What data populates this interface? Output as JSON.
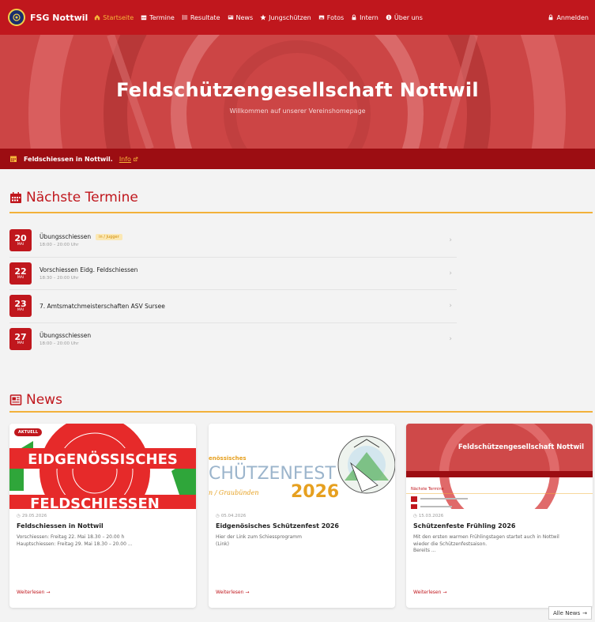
{
  "nav": {
    "brand": "FSG Nottwil",
    "items": [
      {
        "label": "Startseite",
        "icon": "home-icon",
        "active": true
      },
      {
        "label": "Termine",
        "icon": "calendar-icon"
      },
      {
        "label": "Resultate",
        "icon": "list-icon"
      },
      {
        "label": "News",
        "icon": "newspaper-icon"
      },
      {
        "label": "Jungschützen",
        "icon": "star-icon"
      },
      {
        "label": "Fotos",
        "icon": "images-icon"
      },
      {
        "label": "Intern",
        "icon": "lock-icon"
      },
      {
        "label": "Über uns",
        "icon": "info-icon"
      }
    ],
    "login": "Anmelden"
  },
  "hero": {
    "title": "Feldschützengesellschaft Nottwil",
    "subtitle": "Willkommen auf unserer Vereinshomepage"
  },
  "announcement": {
    "text": "Feldschiessen in Nottwil.",
    "link": "Info"
  },
  "events_section": {
    "title": "Nächste Termine",
    "events": [
      {
        "day": "20",
        "month": "MAI",
        "title": "Übungsschiessen",
        "tag": "in / Jugger",
        "time": "18:00 – 20:00 Uhr"
      },
      {
        "day": "22",
        "month": "MAI",
        "title": "Vorschiessen Eidg. Feldschiessen",
        "tag": "",
        "time": "18:30 – 20:00 Uhr"
      },
      {
        "day": "23",
        "month": "MAI",
        "title": "7. Amtsmatchmeisterschaften ASV Sursee",
        "tag": "",
        "time": ""
      },
      {
        "day": "27",
        "month": "MAI",
        "title": "Übungsschiessen",
        "tag": "",
        "time": "18:00 – 20:00 Uhr"
      }
    ]
  },
  "news_section": {
    "title": "News",
    "cards": [
      {
        "badge": "AKTUELL",
        "date": "29.05.2026",
        "title": "Feldschiessen in Nottwil",
        "text_lines": [
          "Vorschiessen: Freitag 22. Mai 18.30 – 20.00 h",
          "Hauptschiessen: Freitag 29. Mai 18.30 – 20.00 ..."
        ],
        "more": "Weiterlesen →",
        "image_text": [
          "EIDGENÖSSISCHES",
          "FELDSCHIESSEN"
        ]
      },
      {
        "date": "05.04.2026",
        "title": "Eidgenösisches Schützenfest 2026",
        "text_lines": [
          "Hier der Link zum Schiessprogramm",
          "(Link)"
        ],
        "more": "Weiterlesen →",
        "image_text": [
          "enössisches",
          "CHÜTZENFEST",
          "n / Graubünden",
          "2026"
        ]
      },
      {
        "date": "15.03.2026",
        "title": "Schützenfeste Frühling 2026",
        "text_lines": [
          "Mit den ersten warmen Frühlingstagen startet auch in Nottwil",
          "wieder die Schützenfestsaison.",
          "Bereits ..."
        ],
        "more": "Weiterlesen →",
        "image_text": [
          "Feldschützengesellschaft Nottwil",
          "Nächste Termine"
        ]
      }
    ],
    "all_news": "Alle News"
  },
  "colors": {
    "primary_red": "#c0171d",
    "dark_red": "#9c0d12",
    "accent_orange": "#f6b53a"
  }
}
